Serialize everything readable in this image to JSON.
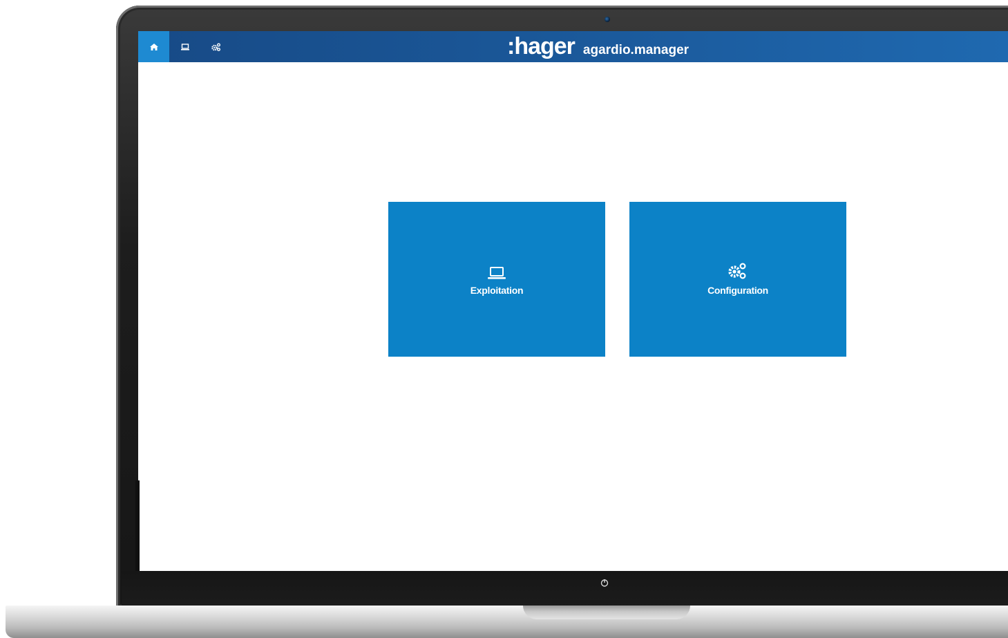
{
  "topbar": {
    "brand_logo": ":hager",
    "brand_product": "agardio.manager",
    "nav": [
      {
        "icon": "home-icon",
        "active": true
      },
      {
        "icon": "laptop-icon",
        "active": false
      },
      {
        "icon": "gears-icon",
        "active": false
      }
    ]
  },
  "tiles": [
    {
      "label": "Exploitation",
      "icon": "laptop-icon"
    },
    {
      "label": "Configuration",
      "icon": "gears-icon"
    }
  ],
  "colors": {
    "topbar": "#1b5a9c",
    "active_nav": "#1e8ad2",
    "tile": "#0c82c7"
  }
}
